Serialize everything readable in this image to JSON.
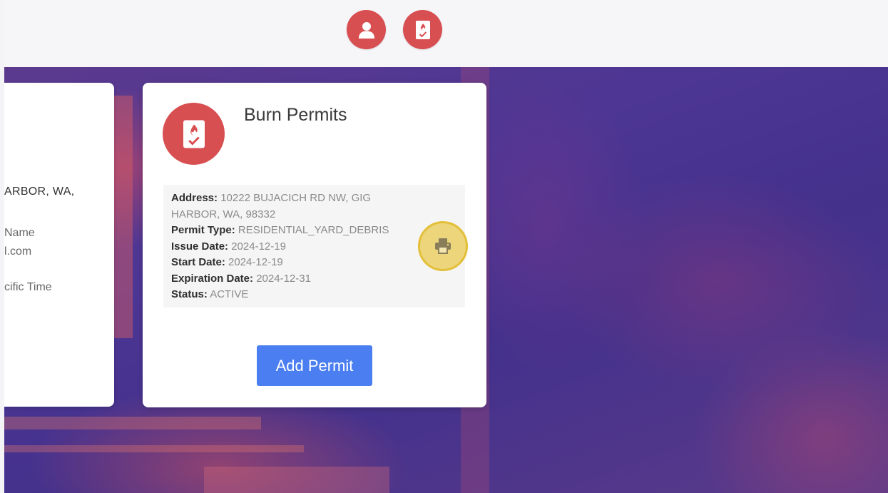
{
  "nav": {
    "icons": [
      "user-icon",
      "burn-permit-icon"
    ],
    "accent_color": "#d84f52"
  },
  "left_card": {
    "address_fragment": "ARBOR, WA,",
    "name_fragment": "Name",
    "email_fragment": "l.com",
    "timezone_fragment": "cific Time"
  },
  "burn_card": {
    "title": "Burn Permits",
    "icon": "burn-permit-icon",
    "fields": {
      "address_label": "Address:",
      "address_value": "10222 BUJACICH RD NW, GIG HARBOR, WA, 98332",
      "permit_type_label": "Permit Type:",
      "permit_type_value": "RESIDENTIAL_YARD_DEBRIS",
      "issue_date_label": "Issue Date:",
      "issue_date_value": "2024-12-19",
      "start_date_label": "Start Date:",
      "start_date_value": "2024-12-19",
      "expiration_date_label": "Expiration Date:",
      "expiration_date_value": "2024-12-31",
      "status_label": "Status:",
      "status_value": "ACTIVE"
    },
    "print_icon": "printer-icon",
    "add_button_label": "Add Permit",
    "add_button_color": "#4b7ef0",
    "highlight_color": "#ecd57a"
  }
}
